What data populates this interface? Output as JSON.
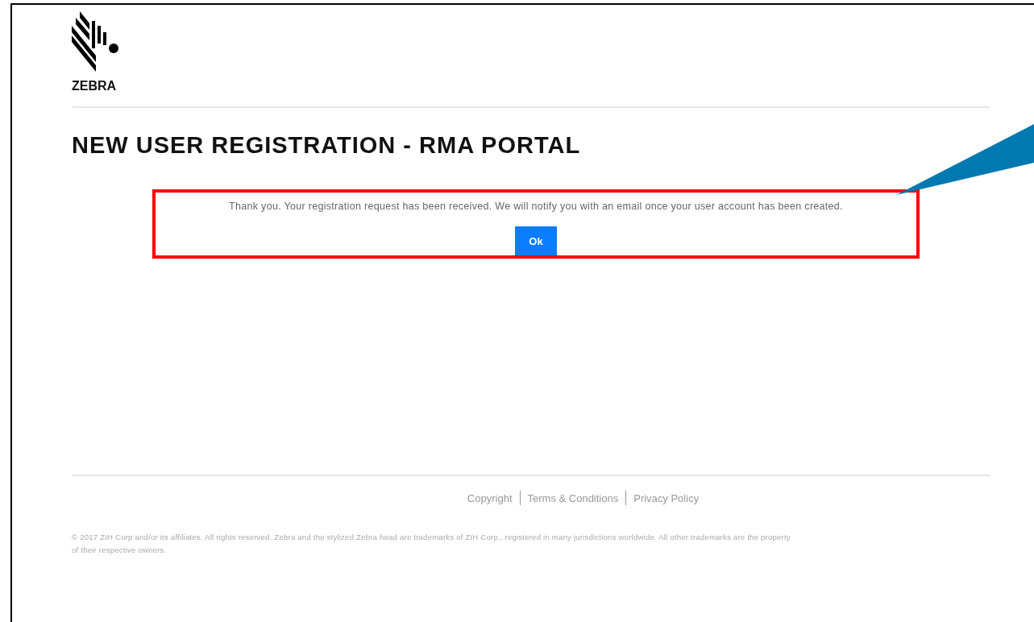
{
  "header": {
    "brand": "ZEBRA"
  },
  "page_title": "NEW USER REGISTRATION - RMA PORTAL",
  "message": {
    "text": "Thank you. Your registration request has been received. We will notify you with an email once your user account has been created.",
    "button": "Ok"
  },
  "footer": {
    "links": [
      "Copyright",
      "Terms & Conditions",
      "Privacy Policy"
    ],
    "legal": [
      "© 2017 ZIH Corp and/or its affiliates. All rights reserved. Zebra and the stylized Zebra head are trademarks of ZIH Corp., registered in many jurisdictions worldwide. All other trademarks are the property",
      "of their respective owners."
    ]
  }
}
